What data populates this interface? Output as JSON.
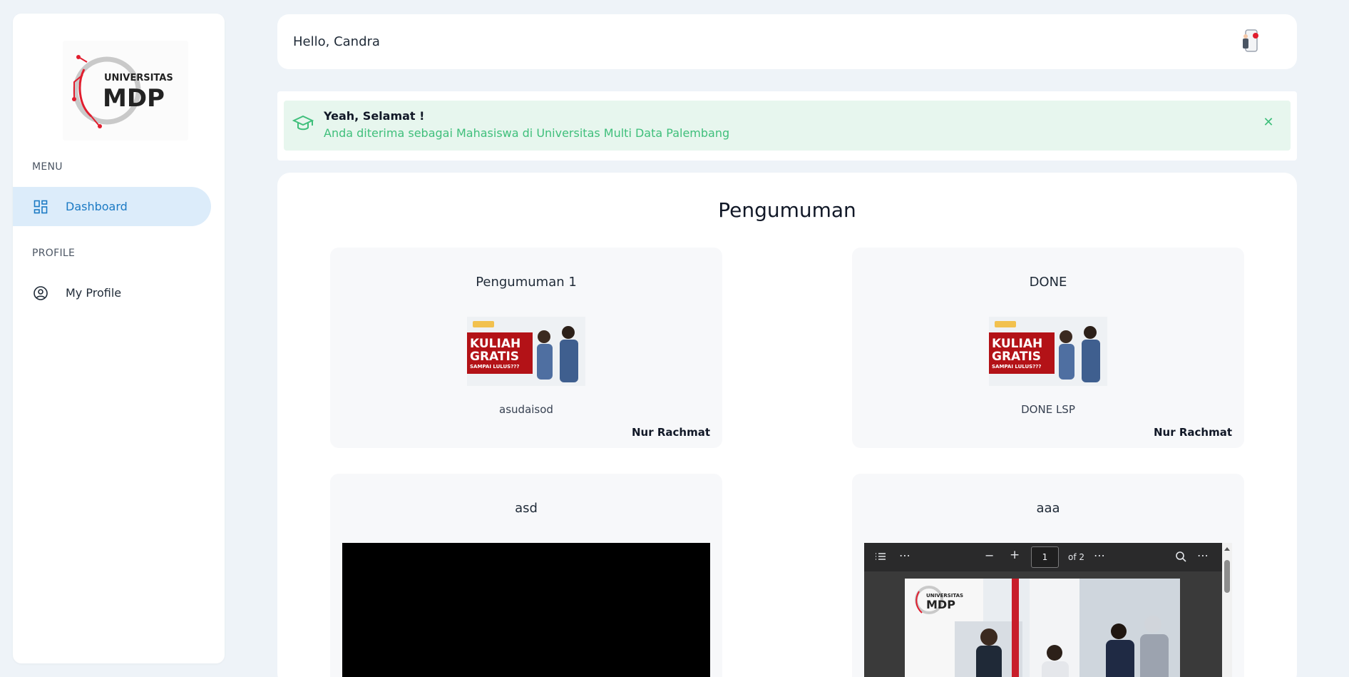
{
  "sidebar": {
    "logo_text_top": "UNIVERSITAS",
    "logo_text_main": "MDP",
    "menu_label": "MENU",
    "profile_label": "PROFILE",
    "items": [
      {
        "label": "Dashboard",
        "icon": "dashboard-grid-icon",
        "active": true
      },
      {
        "label": "My Profile",
        "icon": "user-circle-icon",
        "active": false
      }
    ]
  },
  "header": {
    "greeting": "Hello, Candra"
  },
  "alert": {
    "title": "Yeah, Selamat !",
    "message": "Anda diterima sebagai Mahasiswa di Universitas Multi Data Palembang",
    "accent": "#3fbf7b",
    "background": "#e7f6ee"
  },
  "main": {
    "heading": "Pengumuman",
    "announcements": [
      {
        "title": "Pengumuman 1",
        "media": "image",
        "banner": {
          "line1": "KULIAH",
          "line2": "GRATIS",
          "line3": "SAMPAI LULUS???"
        },
        "description": "asudaisod",
        "author": "Nur Rachmat"
      },
      {
        "title": "DONE",
        "media": "image",
        "banner": {
          "line1": "KULIAH",
          "line2": "GRATIS",
          "line3": "SAMPAI LULUS???"
        },
        "description": "DONE LSP",
        "author": "Nur Rachmat"
      },
      {
        "title": "asd",
        "media": "video"
      },
      {
        "title": "aaa",
        "media": "pdf",
        "pdf": {
          "page": "1",
          "of_pages": "of 2",
          "logo_top": "UNIVERSITAS",
          "logo_main": "MDP"
        }
      }
    ]
  },
  "colors": {
    "page_bg": "#eef3f8",
    "active_nav_bg": "#dcecfa",
    "active_nav_text": "#1b7ac4"
  }
}
